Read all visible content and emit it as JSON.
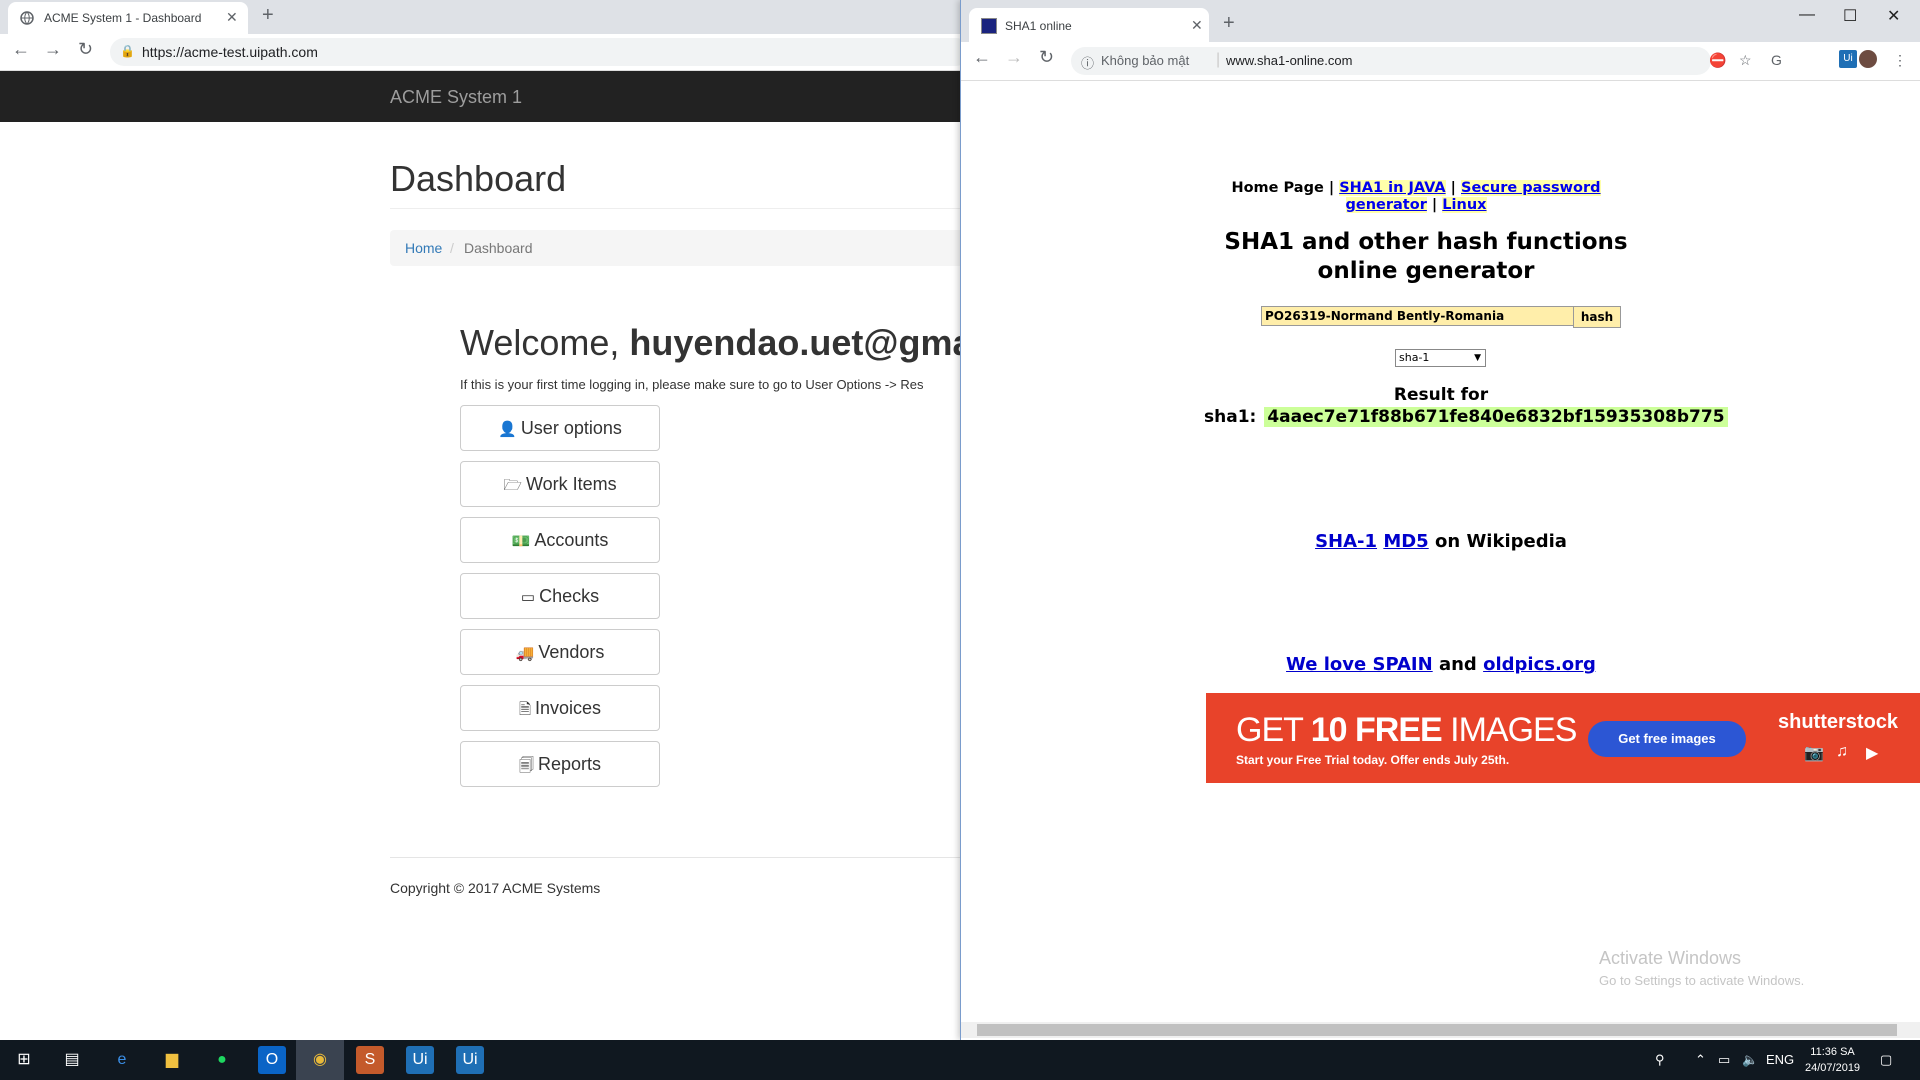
{
  "left_browser": {
    "tab_title": "ACME System 1 - Dashboard",
    "url": "https://acme-test.uipath.com"
  },
  "acme": {
    "brand": "ACME System 1",
    "page_title": "Dashboard",
    "breadcrumb": {
      "home": "Home",
      "sep": "/",
      "current": "Dashboard"
    },
    "welcome_prefix": "Welcome,",
    "welcome_user": "huyendao.uet@gma",
    "first_login_note": "If this is your first time logging in, please make sure to go to User Options -> Res",
    "buttons": [
      {
        "icon": "user-icon",
        "glyph": "👤",
        "label": "User options"
      },
      {
        "icon": "folder-icon",
        "glyph": "🗁",
        "label": "Work Items"
      },
      {
        "icon": "money-icon",
        "glyph": "💵",
        "label": "Accounts"
      },
      {
        "icon": "credit-card-icon",
        "glyph": "▭",
        "label": "Checks"
      },
      {
        "icon": "truck-icon",
        "glyph": "🚚",
        "label": "Vendors"
      },
      {
        "icon": "document-icon",
        "glyph": "🗎",
        "label": "Invoices"
      },
      {
        "icon": "reports-icon",
        "glyph": "🗐",
        "label": "Reports"
      }
    ],
    "copyright": "Copyright © 2017 ACME Systems"
  },
  "right_browser": {
    "tab_title": "SHA1 online",
    "security_label": "Không bảo mật",
    "url": "www.sha1-online.com"
  },
  "sha1": {
    "nav": {
      "home": "Home Page",
      "sep": "|",
      "java": "SHA1 in JAVA",
      "secure1": "Secure password",
      "secure2": "generator",
      "linux": "Linux"
    },
    "heading_line1": "SHA1 and other hash functions",
    "heading_line2": "online generator",
    "input_value": "PO26319-Normand Bently-Romania",
    "hash_button": "hash",
    "algorithm": "sha-1",
    "result_label": "Result for",
    "result_prefix": "sha1:",
    "result_hash": "4aaec7e71f88b671fe840e6832bf15935308b775",
    "wiki": {
      "sha1": "SHA-1",
      "md5": "MD5",
      "suffix": "on Wikipedia"
    },
    "links2": {
      "spain": "We love SPAIN",
      "and": "and",
      "oldpics": "oldpics.org"
    },
    "ad": {
      "headline_pre": "GET",
      "headline_bold": "10 FREE",
      "headline_post": "IMAGES",
      "subline": "Start your Free Trial today. Offer ends July 25th.",
      "cta": "Get free images",
      "brand": "shutterstock"
    },
    "activate_title": "Activate Windows",
    "activate_sub": "Go to Settings to activate Windows."
  },
  "taskbar": {
    "lang": "ENG",
    "time": "11:36 SA",
    "date": "24/07/2019",
    "uipath_label": "Ui"
  },
  "colors": {
    "acme_nav_bg": "#222222",
    "link": "#337ab7",
    "hash_highlight": "#ccff99",
    "ad_bg": "#e8432a",
    "ad_cta": "#2c56d4",
    "taskbar_bg": "#101820"
  }
}
